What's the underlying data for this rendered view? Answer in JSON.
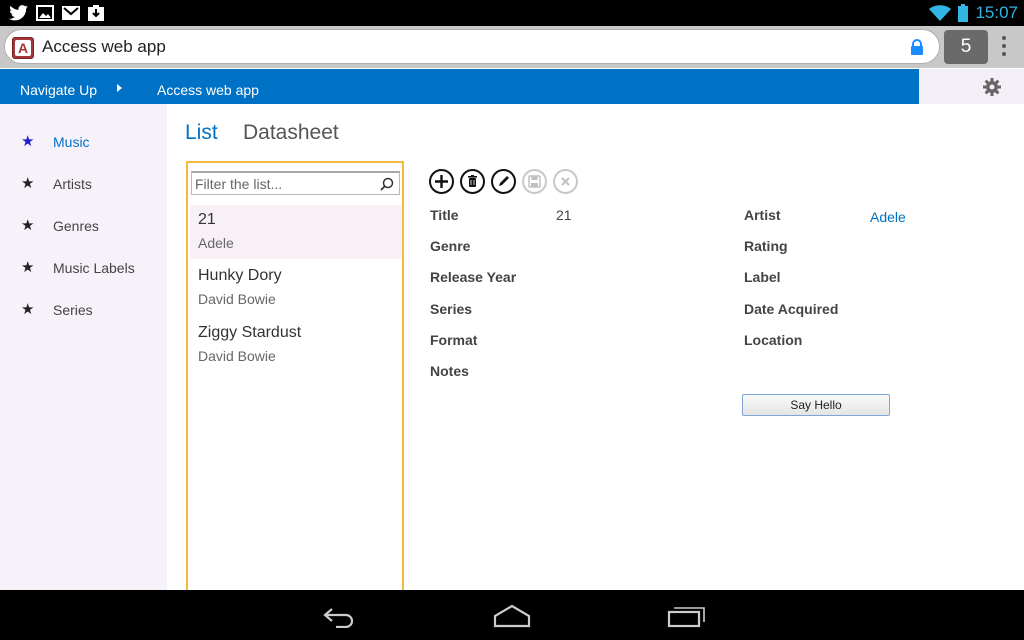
{
  "status_bar": {
    "left_icons": [
      "twitter-icon",
      "gallery-icon",
      "gmail-icon",
      "download-icon"
    ],
    "right_icons": [
      "wifi-icon",
      "battery-icon"
    ],
    "time": "15:07"
  },
  "browser": {
    "url_text": "Access web app",
    "tab_count": "5",
    "favicon_letter": "A"
  },
  "top_nav": {
    "navigate_up": "Navigate Up",
    "app_title": "Access web app"
  },
  "sidebar": {
    "items": [
      {
        "label": "Music",
        "active": true
      },
      {
        "label": "Artists",
        "active": false
      },
      {
        "label": "Genres",
        "active": false
      },
      {
        "label": "Music Labels",
        "active": false
      },
      {
        "label": "Series",
        "active": false
      }
    ]
  },
  "view_tabs": {
    "list": "List",
    "datasheet": "Datasheet"
  },
  "list_panel": {
    "filter_placeholder": "Filter the list...",
    "items": [
      {
        "title": "21",
        "subtitle": "Adele",
        "selected": true
      },
      {
        "title": "Hunky Dory",
        "subtitle": "David Bowie",
        "selected": false
      },
      {
        "title": "Ziggy Stardust",
        "subtitle": "David Bowie",
        "selected": false
      }
    ]
  },
  "actions": [
    "add-icon",
    "delete-icon",
    "edit-icon",
    "save-icon",
    "cancel-icon"
  ],
  "form": {
    "left_fields": [
      {
        "label": "Title",
        "value": "21"
      },
      {
        "label": "Genre",
        "value": ""
      },
      {
        "label": "Release Year",
        "value": ""
      },
      {
        "label": "Series",
        "value": ""
      },
      {
        "label": "Format",
        "value": ""
      },
      {
        "label": "Notes",
        "value": ""
      }
    ],
    "right_fields": [
      {
        "label": "Artist",
        "value": "Adele"
      },
      {
        "label": "Rating",
        "value": ""
      },
      {
        "label": "Label",
        "value": ""
      },
      {
        "label": "Date Acquired",
        "value": ""
      },
      {
        "label": "Location",
        "value": ""
      }
    ],
    "say_hello": "Say Hello"
  },
  "colors": {
    "accent": "#0072c6",
    "selection_border": "#f5b93f",
    "sidebar_bg": "#f7f1fa"
  }
}
